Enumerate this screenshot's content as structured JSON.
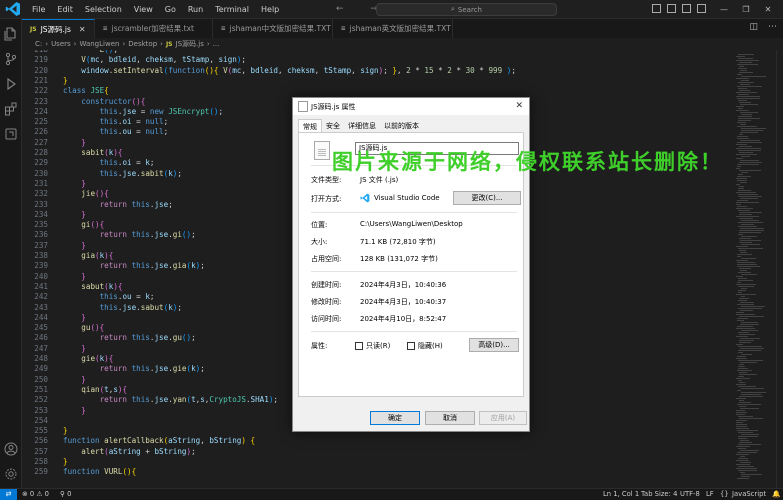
{
  "titlebar": {
    "menu": [
      "File",
      "Edit",
      "Selection",
      "View",
      "Go",
      "Run",
      "Terminal",
      "Help"
    ],
    "search_placeholder": "Search"
  },
  "tabs": [
    {
      "icon": "JS",
      "label": "JS源码.js",
      "active": true
    },
    {
      "icon": "txt",
      "label": "jscrambler加密结果.txt",
      "active": false
    },
    {
      "icon": "txt",
      "label": "jshaman中文版加密结果.TXT",
      "active": false
    },
    {
      "icon": "txt",
      "label": "jshaman英文版加密结果.TXT",
      "active": false
    }
  ],
  "breadcrumb": [
    "C:",
    "Users",
    "WangLiwen",
    "Desktop",
    "JS",
    "JS源码.js",
    "..."
  ],
  "editor": {
    "line_start": 218,
    "line_end": 258
  },
  "statusbar": {
    "errors": "0",
    "warnings": "0",
    "ports": "0",
    "position": "Ln 1, Col 1",
    "tab_size": "Tab Size: 4",
    "encoding": "UTF-8",
    "eol": "LF",
    "braces": "{}",
    "language": "JavaScript"
  },
  "dialog": {
    "title": "JS源码.js 属性",
    "tabs": [
      "常规",
      "安全",
      "详细信息",
      "以前的版本"
    ],
    "filename": "JS源码.js",
    "type_label": "文件类型:",
    "type_value": "JS 文件 (.js)",
    "opens_label": "打开方式:",
    "opens_value": "Visual Studio Code",
    "change_button": "更改(C)...",
    "location_label": "位置:",
    "location_value": "C:\\Users\\WangLiwen\\Desktop",
    "size_label": "大小:",
    "size_value": "71.1 KB (72,810 字节)",
    "disk_label": "占用空间:",
    "disk_value": "128 KB (131,072 字节)",
    "created_label": "创建时间:",
    "created_value": "2024年4月3日，10:40:36",
    "modified_label": "修改时间:",
    "modified_value": "2024年4月3日，10:40:37",
    "accessed_label": "访问时间:",
    "accessed_value": "2024年4月10日，8:52:47",
    "attr_label": "属性:",
    "readonly_label": "只读(R)",
    "hidden_label": "隐藏(H)",
    "advanced_button": "高级(D)...",
    "ok_button": "确定",
    "cancel_button": "取消",
    "apply_button": "应用(A)"
  },
  "watermark": "图片来源于网络，侵权联系站长删除！",
  "colors": {
    "accent": "#0078d4",
    "editor_bg": "#1e1e1e",
    "watermark": "#3fcf2a"
  }
}
